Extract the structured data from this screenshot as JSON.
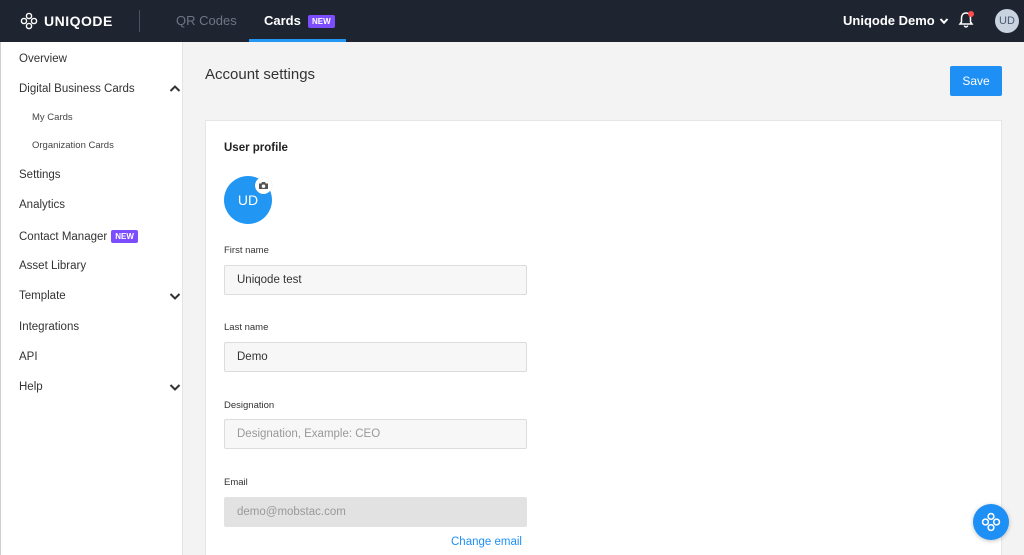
{
  "brand": {
    "name": "UNIQODE",
    "logo_icon": "uniqode-logo-icon"
  },
  "nav": {
    "tabs": [
      {
        "label": "QR Codes",
        "active": false
      },
      {
        "label": "Cards",
        "active": true,
        "badge": "NEW"
      }
    ]
  },
  "user_menu": {
    "label": "Uniqode Demo",
    "icon": "chevron-down-icon"
  },
  "notifications": {
    "icon": "bell-icon",
    "has_unread": true
  },
  "top_avatar": {
    "initials": "UD"
  },
  "sidebar": {
    "items": [
      {
        "label": "Overview"
      },
      {
        "label": "Digital Business Cards",
        "expanded": true
      },
      {
        "label": "My Cards",
        "sub": true
      },
      {
        "label": "Organization Cards",
        "sub": true
      },
      {
        "label": "Settings"
      },
      {
        "label": "Analytics"
      },
      {
        "label": "Contact Manager",
        "badge": "NEW"
      },
      {
        "label": "Asset Library"
      },
      {
        "label": "Template",
        "expanded": false
      },
      {
        "label": "Integrations"
      },
      {
        "label": "API"
      },
      {
        "label": "Help",
        "expanded": false
      }
    ]
  },
  "page": {
    "title": "Account settings",
    "save_label": "Save"
  },
  "profile": {
    "section_title": "User profile",
    "avatar_initials": "UD",
    "avatar_color": "#2196f3",
    "camera_icon": "camera-icon",
    "fields": {
      "first_name": {
        "label": "First name",
        "value": "Uniqode test"
      },
      "last_name": {
        "label": "Last name",
        "value": "Demo"
      },
      "designation": {
        "label": "Designation",
        "value": "",
        "placeholder": "Designation, Example: CEO"
      },
      "email": {
        "label": "Email",
        "value": "",
        "placeholder": "demo@mobstac.com",
        "disabled": true
      }
    },
    "change_email_label": "Change email"
  },
  "colors": {
    "accent": "#1e8ff5",
    "topbar": "#1e2430",
    "badge": "#7c4dff"
  }
}
